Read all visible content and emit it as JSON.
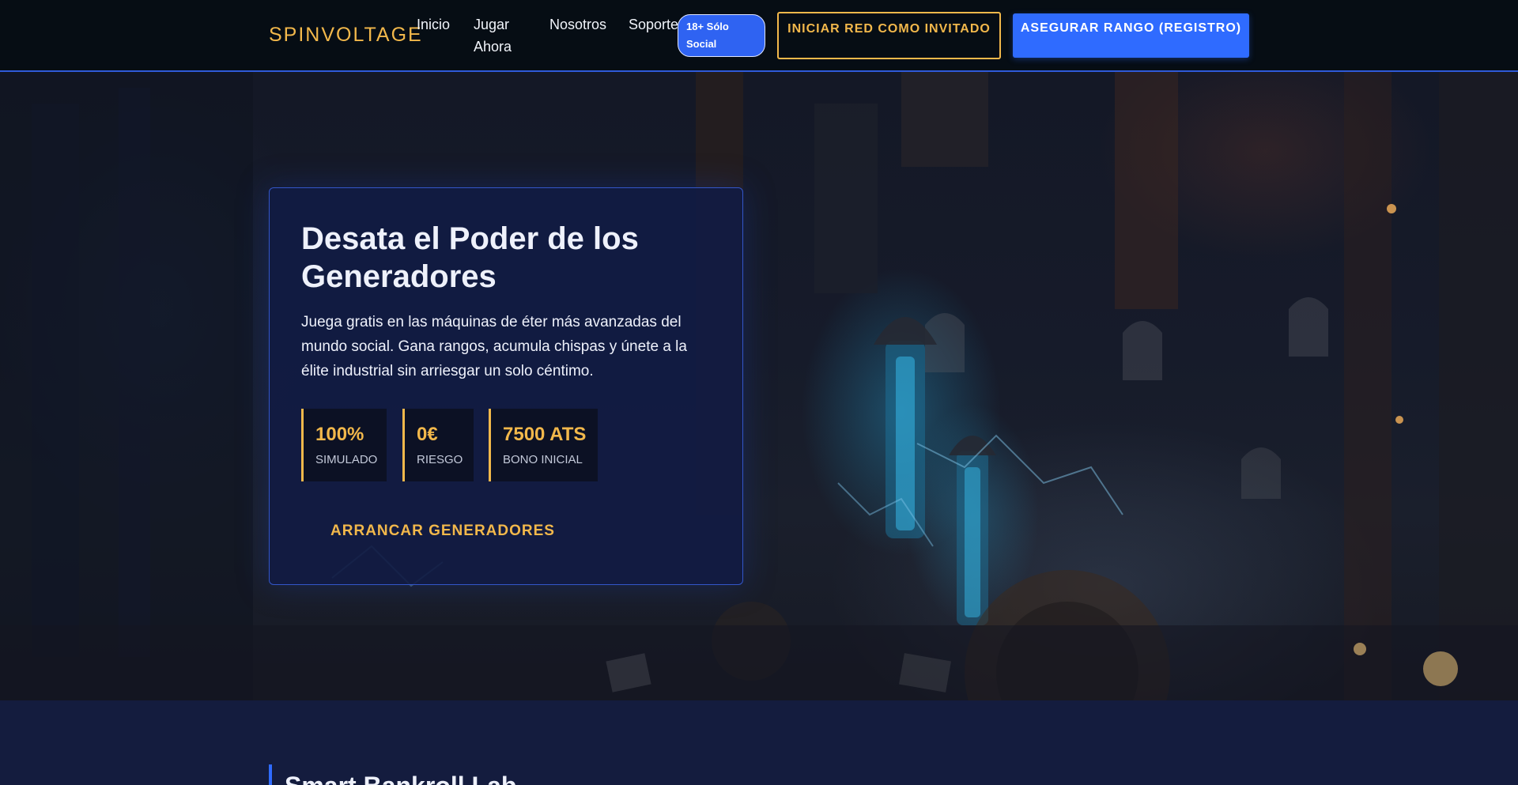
{
  "header": {
    "logo": "SPINVOLTAGE",
    "nav": {
      "inicio": "Inicio",
      "jugar": "Jugar Ahora",
      "nosotros": "Nosotros",
      "soporte": "Soporte"
    },
    "age_badge": "18+ Sólo Social",
    "guest_button": "INICIAR RED COMO INVITADO",
    "register_button": "ASEGURAR RANGO (REGISTRO)"
  },
  "hero": {
    "title": "Desata el Poder de los Generadores",
    "description": "Juega gratis en las máquinas de éter más avanzadas del mundo social. Gana rangos, acumula chispas y únete a la élite industrial sin arriesgar un solo céntimo.",
    "stats": [
      {
        "value": "100%",
        "label": "SIMULADO"
      },
      {
        "value": "0€",
        "label": "RIESGO"
      },
      {
        "value": "7500 ATS",
        "label": "BONO INICIAL"
      }
    ],
    "cta": "ARRANCAR GENERADORES"
  },
  "section": {
    "title": "Smart Bankroll Lab"
  },
  "colors": {
    "accent_gold": "#f2b84b",
    "accent_blue": "#2f6bff",
    "header_bg": "#060d14",
    "card_bg": "#111b44"
  }
}
